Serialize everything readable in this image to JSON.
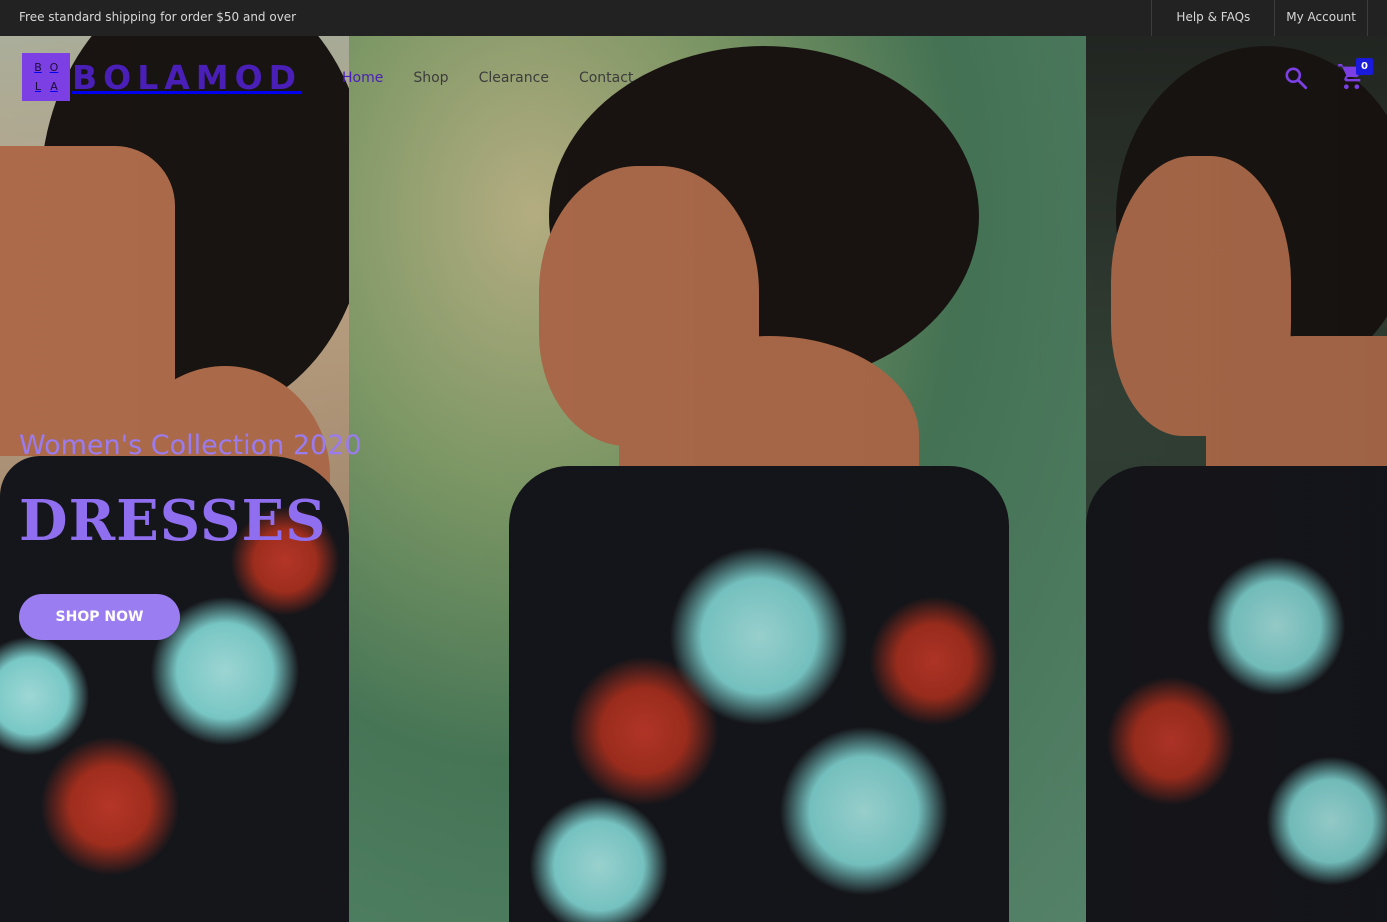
{
  "topbar": {
    "promo": "Free standard shipping for order $50 and over",
    "links": [
      "Help & FAQs",
      "My Account"
    ]
  },
  "brand": {
    "logo_letters": [
      "B",
      "O",
      "L",
      "A"
    ],
    "name": "BOLAMOD",
    "accent_color": "#4a1fb8"
  },
  "nav": {
    "items": [
      "Home",
      "Shop",
      "Clearance",
      "Contact"
    ],
    "active": "Home"
  },
  "header": {
    "cart_count": "0",
    "icons": [
      "search-icon",
      "cart-icon"
    ]
  },
  "hero": {
    "subtitle": "Women's Collection 2020",
    "title": "DRESSES",
    "cta_label": "SHOP NOW",
    "text_color": "#8f6ff0",
    "button_color": "#9b7df2"
  }
}
